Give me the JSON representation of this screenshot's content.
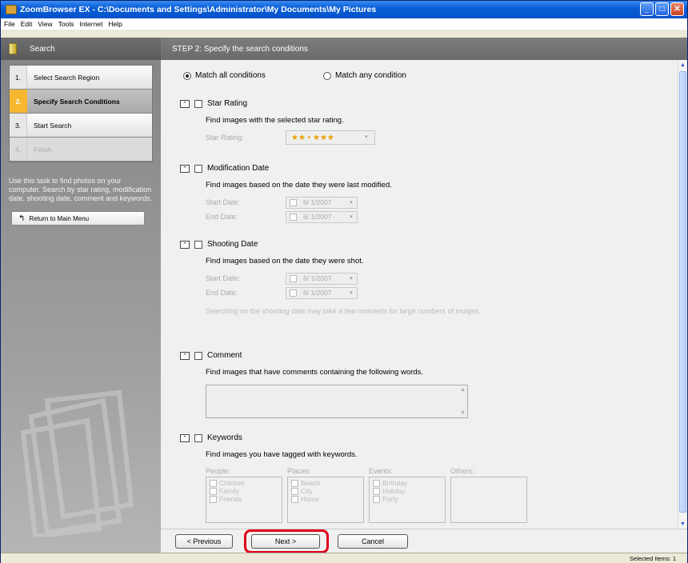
{
  "window": {
    "title": "ZoomBrowser EX  -  C:\\Documents and Settings\\Administrator\\My Documents\\My Pictures",
    "minimize_icon": "minimize-icon",
    "maximize_icon": "maximize-icon",
    "close_icon": "close-icon"
  },
  "menu": [
    "File",
    "Edit",
    "View",
    "Tools",
    "Internet",
    "Help"
  ],
  "sidebar": {
    "title": "Search",
    "steps": [
      {
        "num": "1.",
        "label": "Select Search Region"
      },
      {
        "num": "2.",
        "label": "Specify Search Conditions"
      },
      {
        "num": "3.",
        "label": "Start Search"
      },
      {
        "num": "4.",
        "label": "Finish"
      }
    ],
    "description": "Use this task to find photos on your computer. Search by star rating, modification date, shooting date, comment and keywords.",
    "return_label": "Return to Main Menu"
  },
  "main": {
    "header": "STEP 2: Specify the search conditions",
    "match_all": "Match all conditions",
    "match_any": "Match any condition",
    "star": {
      "title": "Star Rating",
      "desc": "Find images with the selected star rating.",
      "field_label": "Star Rating:",
      "value": "★★ • ★★★"
    },
    "modification": {
      "title": "Modification Date",
      "desc": "Find images based on the date they were last modified.",
      "start_label": "Start Date:",
      "end_label": "End Date:",
      "start_value": "6/ 1/2007",
      "end_value": "6/ 1/2007"
    },
    "shooting": {
      "title": "Shooting Date",
      "desc": "Find images based on the date they were shot.",
      "start_label": "Start Date:",
      "end_label": "End Date:",
      "start_value": "6/ 1/2007",
      "end_value": "6/ 1/2007",
      "note": "Searching on the shooting date may take a few moments for large numbers of images."
    },
    "comment": {
      "title": "Comment",
      "desc": "Find images that have comments containing the following words."
    },
    "keywords": {
      "title": "Keywords",
      "desc": "Find images you have tagged with keywords.",
      "people_label": "People:",
      "places_label": "Places:",
      "events_label": "Events:",
      "others_label": "Others:",
      "people": [
        "Children",
        "Family",
        "Friends"
      ],
      "places": [
        "Beach",
        "City",
        "Home"
      ],
      "events": [
        "Birthday",
        "Holiday",
        "Party"
      ]
    }
  },
  "buttons": {
    "previous": "< Previous",
    "next": "Next >",
    "cancel": "Cancel"
  },
  "status": {
    "selected": "Selected Items: 1"
  },
  "colors": {
    "highlight": "#e0001a",
    "active_step": "#f7b731",
    "title_bar": "#0a5ed6"
  }
}
